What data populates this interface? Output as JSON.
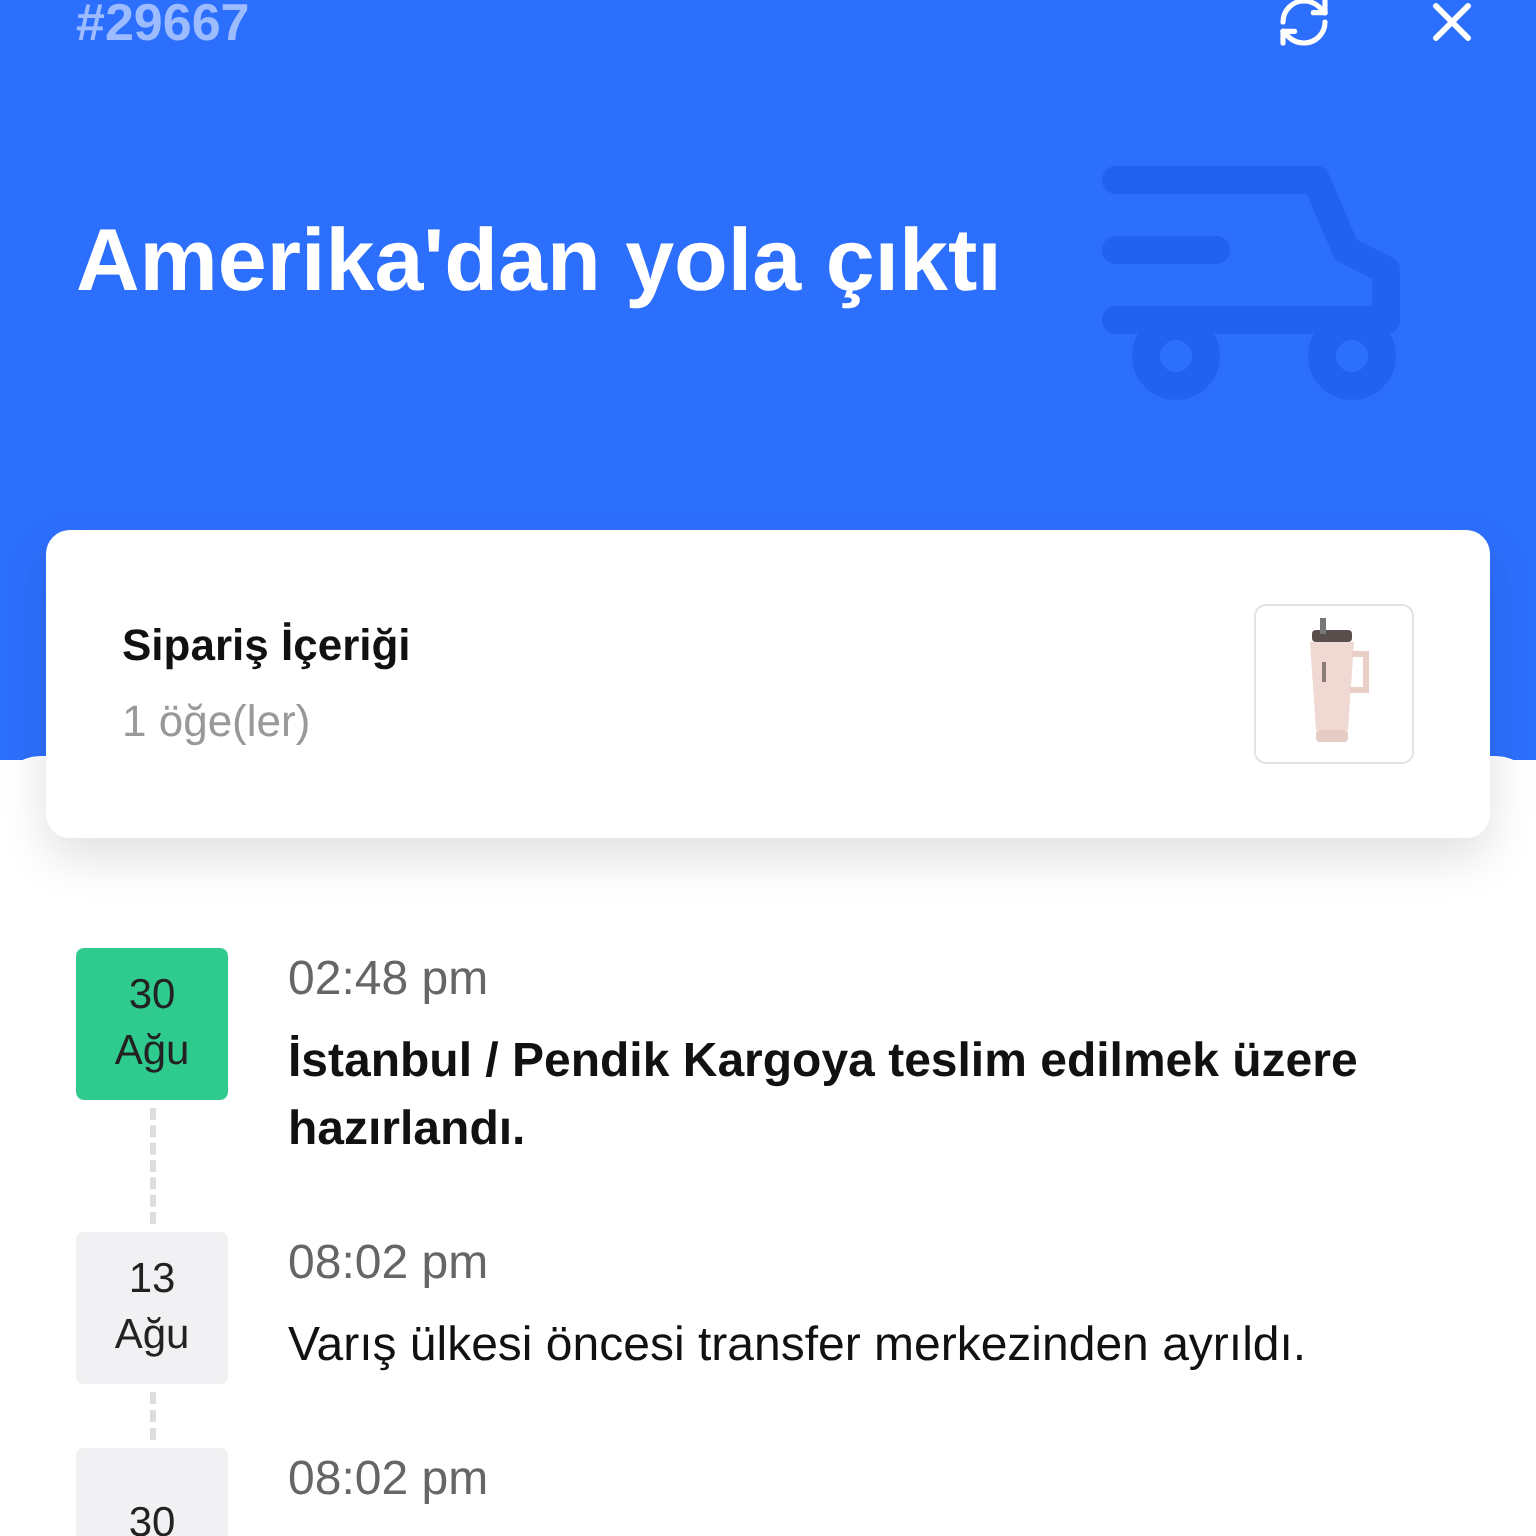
{
  "header": {
    "order_number": "#29667",
    "title": "Amerika'dan yola çıktı"
  },
  "order_card": {
    "title": "Sipariş İçeriği",
    "count": "1 öğe(ler)"
  },
  "timeline": [
    {
      "day": "30",
      "month": "Ağu",
      "time": "02:48 pm",
      "text": "İstanbul / Pendik Kargoya teslim edilmek üzere hazırlandı.",
      "current": true
    },
    {
      "day": "13",
      "month": "Ağu",
      "time": "08:02 pm",
      "text": "Varış ülkesi öncesi transfer merkezinden ayrıldı.",
      "current": false
    },
    {
      "day": "30",
      "time": "08:02 pm",
      "current": false
    }
  ]
}
